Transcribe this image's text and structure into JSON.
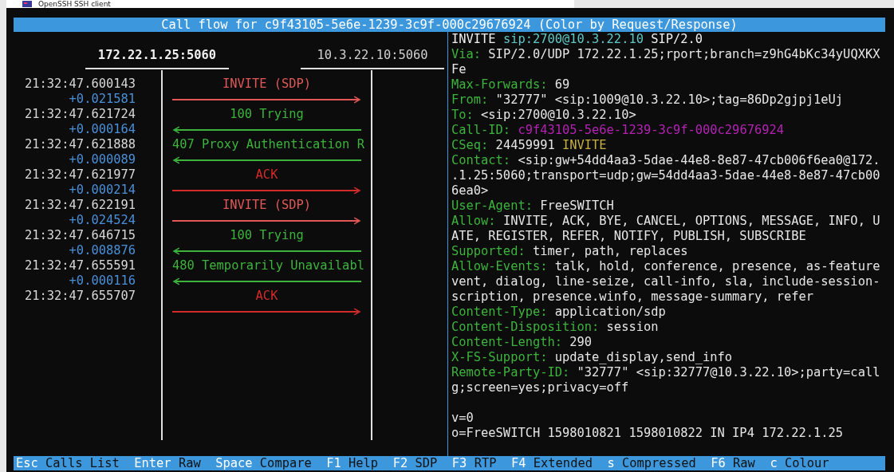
{
  "window": {
    "title": "OpenSSH SSH client"
  },
  "title_bar": "Call flow for c9f43105-5e6e-1239-3c9f-000c29676924 (Color by Request/Response)",
  "call_flow": {
    "hosts": [
      "172.22.1.25:5060",
      "10.3.22.10:5060"
    ],
    "messages": [
      {
        "time": "21:32:47.600143",
        "delta": "+0.021581",
        "label": "INVITE (SDP)",
        "kind": "request",
        "to_right": true
      },
      {
        "time": "21:32:47.621724",
        "delta": "+0.000164",
        "label": "100 Trying",
        "kind": "response",
        "to_right": false
      },
      {
        "time": "21:32:47.621888",
        "delta": "+0.000089",
        "label": "407 Proxy Authentication R",
        "kind": "response",
        "to_right": false
      },
      {
        "time": "21:32:47.621977",
        "delta": "+0.000214",
        "label": "ACK",
        "kind": "ack",
        "to_right": true
      },
      {
        "time": "21:32:47.622191",
        "delta": "+0.024524",
        "label": "INVITE (SDP)",
        "kind": "request",
        "to_right": true
      },
      {
        "time": "21:32:47.646715",
        "delta": "+0.008876",
        "label": "100 Trying",
        "kind": "response",
        "to_right": false
      },
      {
        "time": "21:32:47.655591",
        "delta": "+0.000116",
        "label": "480 Temporarily Unavailabl",
        "kind": "response",
        "to_right": false
      },
      {
        "time": "21:32:47.655707",
        "label": "ACK",
        "kind": "ack",
        "to_right": true
      }
    ]
  },
  "message_lines": [
    {
      "parts": [
        {
          "kind": "method",
          "text": "INVITE"
        },
        {
          "kind": "uri",
          "text": "sip:2700@10.3.22.10"
        },
        {
          "kind": "method",
          "text": "SIP/2.0"
        }
      ]
    },
    {
      "parts": [
        {
          "kind": "header",
          "text": "Via:"
        },
        {
          "kind": "value",
          "text": "SIP/2.0/UDP 172.22.1.25;rport;branch=z9hG4bKc34yUQXKX"
        }
      ]
    },
    {
      "parts": [
        {
          "kind": "value",
          "text": "Fe"
        }
      ]
    },
    {
      "parts": [
        {
          "kind": "header",
          "text": "Max-Forwards:"
        },
        {
          "kind": "value",
          "text": "69"
        }
      ]
    },
    {
      "parts": [
        {
          "kind": "header",
          "text": "From:"
        },
        {
          "kind": "value",
          "text": "\"32777\" <sip:1009@10.3.22.10>;tag=86Dp2gjpj1eUj"
        }
      ]
    },
    {
      "parts": [
        {
          "kind": "header",
          "text": "To:"
        },
        {
          "kind": "value",
          "text": "<sip:2700@10.3.22.10>"
        }
      ]
    },
    {
      "parts": [
        {
          "kind": "header",
          "text": "Call-ID:"
        },
        {
          "kind": "callid",
          "text": "c9f43105-5e6e-1239-3c9f-000c29676924"
        }
      ]
    },
    {
      "parts": [
        {
          "kind": "header",
          "text": "CSeq:"
        },
        {
          "kind": "value",
          "text": "24459991"
        },
        {
          "kind": "cseq_method",
          "text": "INVITE"
        }
      ]
    },
    {
      "parts": [
        {
          "kind": "header",
          "text": "Contact:"
        },
        {
          "kind": "value",
          "text": "<sip:gw+54dd4aa3-5dae-44e8-8e87-47cb006f6ea0@172."
        }
      ]
    },
    {
      "parts": [
        {
          "kind": "value",
          "text": ".1.25:5060;transport=udp;gw=54dd4aa3-5dae-44e8-8e87-47cb00"
        }
      ]
    },
    {
      "parts": [
        {
          "kind": "value",
          "text": "6ea0>"
        }
      ]
    },
    {
      "parts": [
        {
          "kind": "header",
          "text": "User-Agent:"
        },
        {
          "kind": "value",
          "text": "FreeSWITCH"
        }
      ]
    },
    {
      "parts": [
        {
          "kind": "header",
          "text": "Allow:"
        },
        {
          "kind": "value",
          "text": "INVITE, ACK, BYE, CANCEL, OPTIONS, MESSAGE, INFO, U"
        }
      ]
    },
    {
      "parts": [
        {
          "kind": "value",
          "text": "ATE, REGISTER, REFER, NOTIFY, PUBLISH, SUBSCRIBE"
        }
      ]
    },
    {
      "parts": [
        {
          "kind": "header",
          "text": "Supported:"
        },
        {
          "kind": "value",
          "text": "timer, path, replaces"
        }
      ]
    },
    {
      "parts": [
        {
          "kind": "header",
          "text": "Allow-Events:"
        },
        {
          "kind": "value",
          "text": "talk, hold, conference, presence, as-feature"
        }
      ]
    },
    {
      "parts": [
        {
          "kind": "value",
          "text": "vent, dialog, line-seize, call-info, sla, include-session-"
        }
      ]
    },
    {
      "parts": [
        {
          "kind": "value",
          "text": "scription, presence.winfo, message-summary, refer"
        }
      ]
    },
    {
      "parts": [
        {
          "kind": "header",
          "text": "Content-Type:"
        },
        {
          "kind": "value",
          "text": "application/sdp"
        }
      ]
    },
    {
      "parts": [
        {
          "kind": "header",
          "text": "Content-Disposition:"
        },
        {
          "kind": "value",
          "text": "session"
        }
      ]
    },
    {
      "parts": [
        {
          "kind": "header",
          "text": "Content-Length:"
        },
        {
          "kind": "value",
          "text": "290"
        }
      ]
    },
    {
      "parts": [
        {
          "kind": "header",
          "text": "X-FS-Support:"
        },
        {
          "kind": "value",
          "text": "update_display,send_info"
        }
      ]
    },
    {
      "parts": [
        {
          "kind": "header",
          "text": "Remote-Party-ID:"
        },
        {
          "kind": "value",
          "text": "\"32777\" <sip:32777@10.3.22.10>;party=call"
        }
      ]
    },
    {
      "parts": [
        {
          "kind": "value",
          "text": "g;screen=yes;privacy=off"
        }
      ]
    },
    {
      "blank_before": true,
      "parts": [
        {
          "kind": "value",
          "text": "v=0"
        }
      ]
    },
    {
      "parts": [
        {
          "kind": "value",
          "text": "o=FreeSWITCH 1598010821 1598010822 IN IP4 172.22.1.25"
        }
      ]
    }
  ],
  "key_bar": [
    {
      "key": "Esc",
      "label": "Calls List"
    },
    {
      "key": "Enter",
      "label": "Raw"
    },
    {
      "key": "Space",
      "label": "Compare"
    },
    {
      "key": "F1",
      "label": "Help"
    },
    {
      "key": "F2",
      "label": "SDP"
    },
    {
      "key": "F3",
      "label": "RTP"
    },
    {
      "key": "F4",
      "label": "Extended"
    },
    {
      "key": "s",
      "label": "Compressed"
    },
    {
      "key": "F6",
      "label": "Raw"
    },
    {
      "key": "c",
      "label": "Colour"
    }
  ]
}
